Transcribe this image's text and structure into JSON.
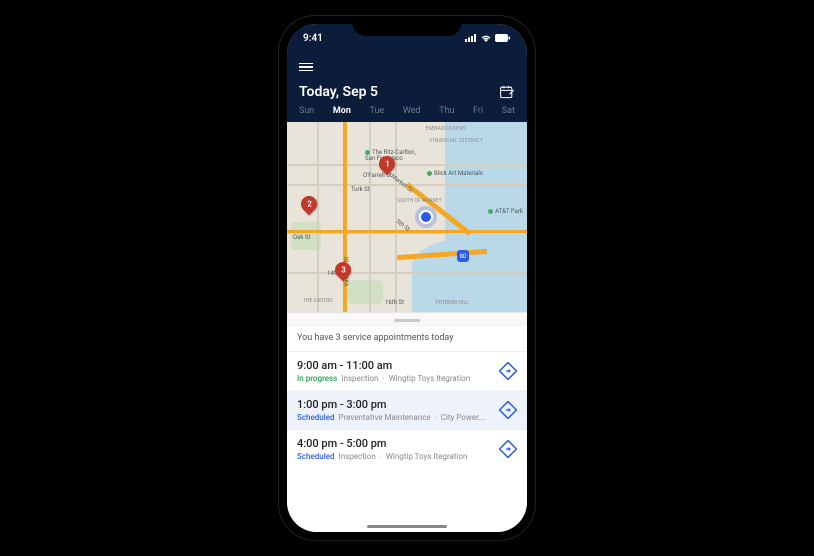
{
  "status": {
    "time": "9:41"
  },
  "header": {
    "title": "Today, Sep 5"
  },
  "days": [
    {
      "label": "Sun"
    },
    {
      "label": "Mon"
    },
    {
      "label": "Tue"
    },
    {
      "label": "Wed"
    },
    {
      "label": "Thu"
    },
    {
      "label": "Fri"
    },
    {
      "label": "Sat"
    }
  ],
  "active_day_index": 1,
  "map": {
    "pins": [
      {
        "n": "1"
      },
      {
        "n": "2"
      },
      {
        "n": "3"
      }
    ],
    "poi": {
      "ritz": "The Ritz-Carlton, San Francisco",
      "blick": "Blick Art Materials",
      "att": "AT&T Park",
      "emb": "EMBARCADERO",
      "fin": "FINANCIAL DISTRICT",
      "soma": "SOUTH OF MARKET",
      "castro": "THE CASTRO",
      "turk": "Turk St",
      "ofarrell": "O'Farrell St",
      "oak": "Oak St",
      "market": "Market St",
      "fourteenth": "14th St",
      "fifth": "5th St",
      "sixteenth": "16th St",
      "valencia": "Valencia St",
      "potrero": "POTRERO HILL",
      "hwy": "80"
    }
  },
  "summary": "You have 3 service appointments today",
  "appointments": [
    {
      "time": "9:00 am - 11:00 am",
      "status": "In progress",
      "status_class": "progress",
      "type": "Inspection",
      "customer": "Wingtip Toys Itegration"
    },
    {
      "time": "1:00 pm - 3:00 pm",
      "status": "Scheduled",
      "status_class": "scheduled",
      "type": "Preventative Maintenance",
      "customer": "City Power..."
    },
    {
      "time": "4:00 pm - 5:00 pm",
      "status": "Scheduled",
      "status_class": "scheduled",
      "type": "Inspection",
      "customer": "Wingtip Toys Itegration"
    }
  ]
}
